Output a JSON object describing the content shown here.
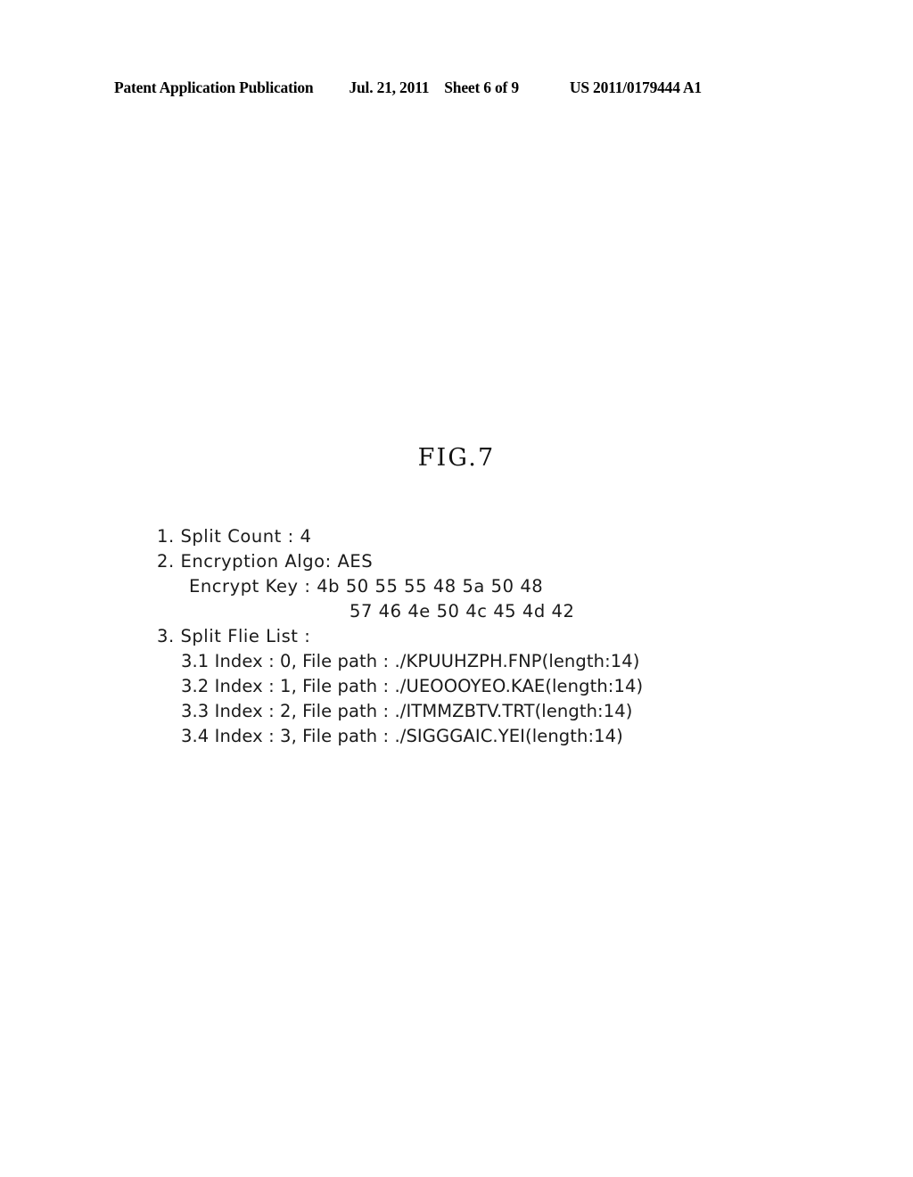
{
  "header": {
    "title": "Patent Application Publication",
    "date": "Jul. 21, 2011",
    "sheet": "Sheet 6 of 9",
    "publication_number": "US 2011/0179444 A1"
  },
  "figure": {
    "label": "FIG.7"
  },
  "listing": {
    "line1": "1. Split Count : 4",
    "line2": "2. Encryption Algo: AES",
    "encrypt_key_label": "Encrypt Key : 4b 50 55 55 48 5a 50 48",
    "encrypt_key_cont": "57 46 4e 50 4c 45 4d 42",
    "line3": "3. Split Flie List :",
    "items": [
      "3.1 Index : 0, File path : ./KPUUHZPH.FNP(length:14)",
      "3.2 Index : 1, File path : ./UEOOOYEO.KAE(length:14)",
      "3.3 Index : 2, File path : ./ITMMZBTV.TRT(length:14)",
      "3.4 Index : 3, File path : ./SIGGGAIC.YEI(length:14)"
    ]
  }
}
